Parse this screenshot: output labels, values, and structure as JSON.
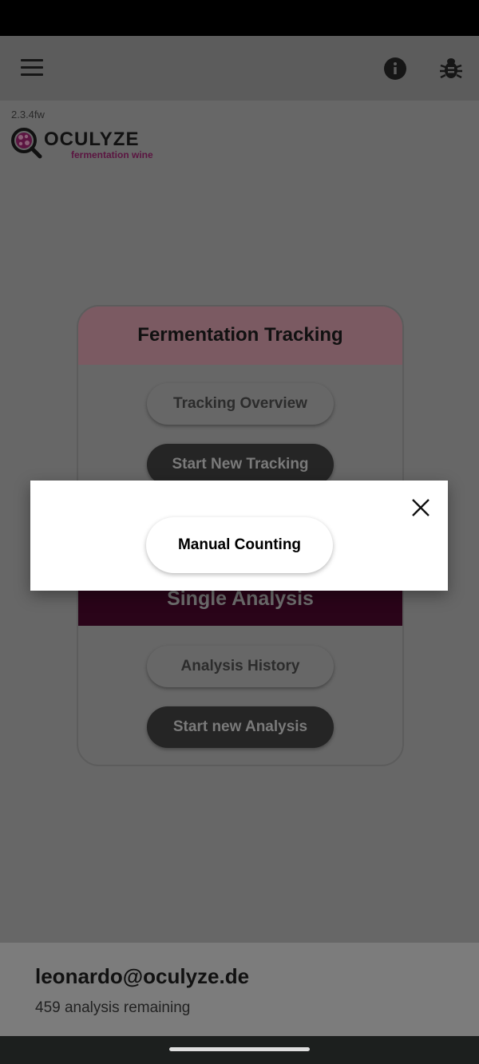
{
  "app": {
    "version": "2.3.4fw",
    "logo": {
      "name": "OCULYZE",
      "subtitle": "fermentation wine"
    },
    "icons": {
      "menu": "menu-icon",
      "info": "info-icon",
      "debug": "bug-icon"
    }
  },
  "fermentation_tracking": {
    "title": "Fermentation Tracking",
    "tracking_overview_label": "Tracking Overview",
    "start_new_tracking_label": "Start New Tracking"
  },
  "single_analysis": {
    "title": "Single Analysis",
    "analysis_history_label": "Analysis History",
    "start_new_analysis_label": "Start new Analysis"
  },
  "dialog": {
    "manual_counting_label": "Manual Counting",
    "close_icon": "close-icon"
  },
  "footer": {
    "email": "leonardo@oculyze.de",
    "remaining": "459 analysis remaining"
  },
  "colors": {
    "brand_purple": "#5b1541",
    "tracking_header": "#7b5a62",
    "analysis_header": "#2a0419"
  }
}
